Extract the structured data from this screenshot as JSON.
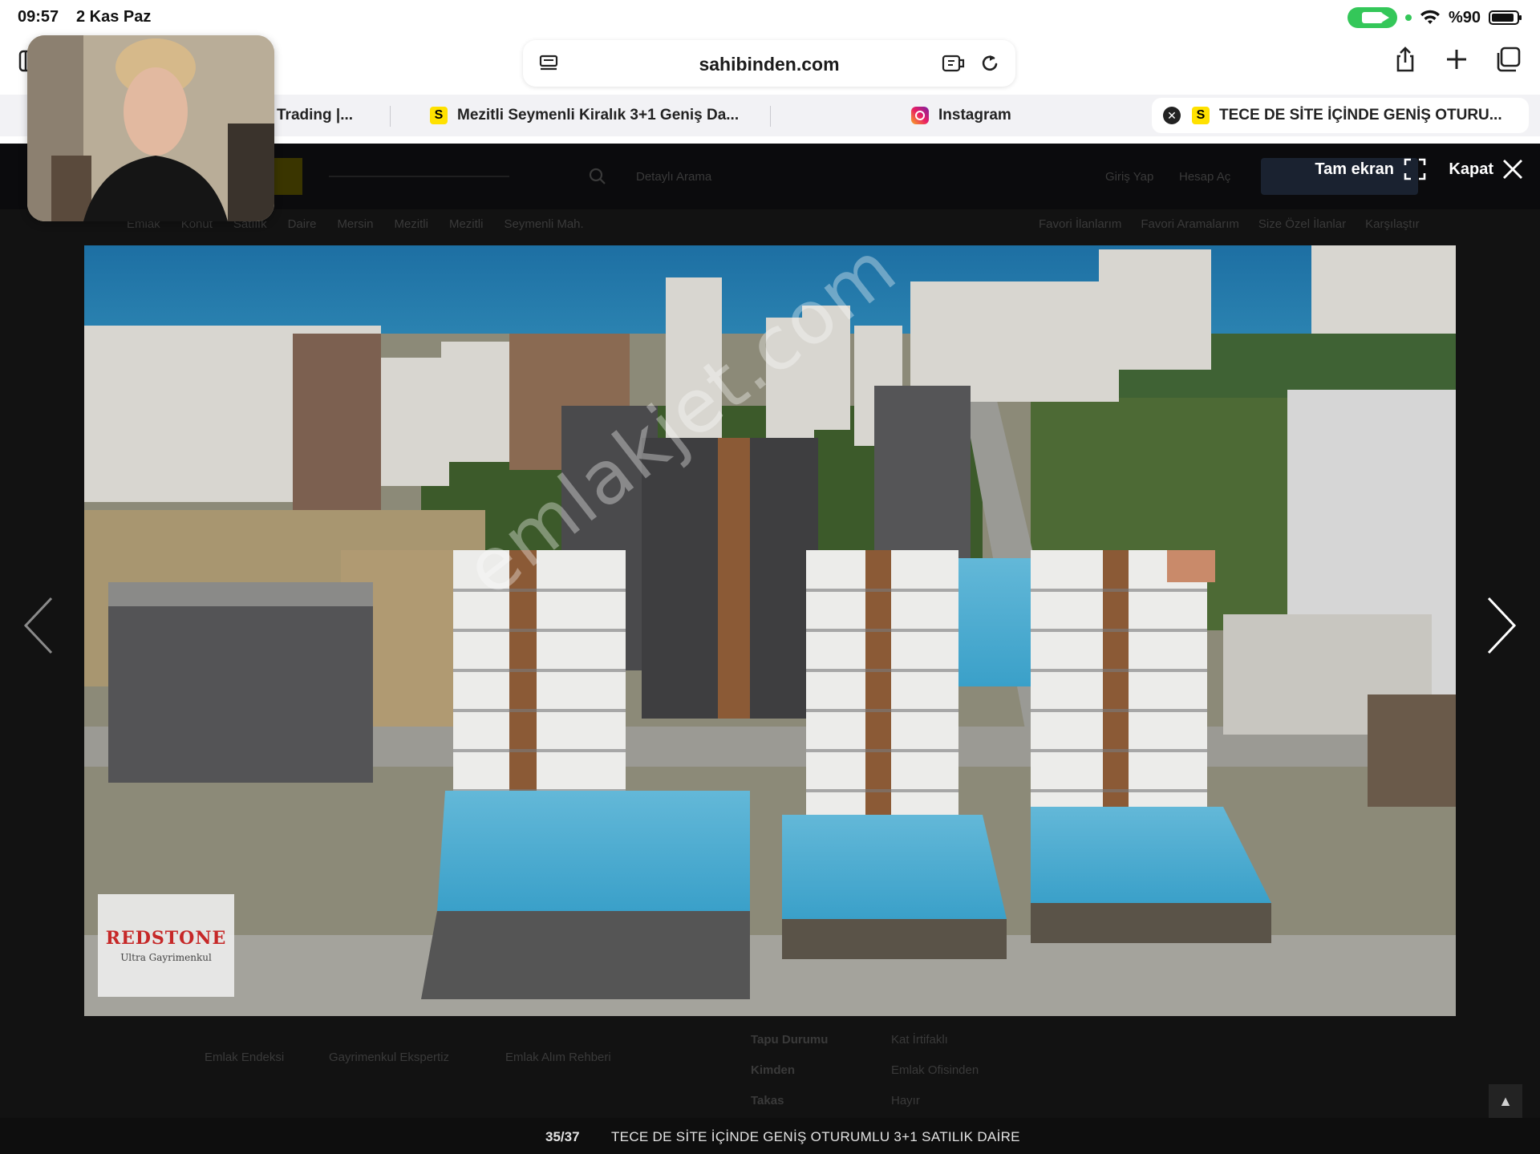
{
  "status": {
    "time": "09:57",
    "date": "2 Kas Paz",
    "battery": "%90",
    "battery_level": 0.9
  },
  "browser": {
    "url": "sahibinden.com",
    "tabs": [
      {
        "label": "Trading |...",
        "favicon": "none"
      },
      {
        "label": "Mezitli Seymenli Kiralık 3+1 Geniş Da...",
        "favicon": "sahibinden-icon"
      },
      {
        "label": "Instagram",
        "favicon": "instagram-icon"
      },
      {
        "label": "TECE DE SİTE İÇİNDE GENİŞ OTURU...",
        "favicon": "sahibinden-icon",
        "active": true
      }
    ]
  },
  "lightbox": {
    "fullscreen_label": "Tam ekran",
    "close_label": "Kapat",
    "counter": "35/37",
    "caption": "TECE DE SİTE İÇİNDE GENİŞ OTURUMLU 3+1 SATILIK DAİRE",
    "watermark": "emlakjet.com",
    "logo_brand": "REDSTONE",
    "logo_sub": "Ultra Gayrimenkul"
  },
  "background_page": {
    "nav_links": [
      "Detaylı Arama",
      "Giriş Yap",
      "Hesap Aç"
    ],
    "breadcrumb": [
      "Emlak",
      "Konut",
      "Satılık",
      "Daire",
      "Mersin",
      "Mezitli",
      "Mezitli",
      "Seymenli Mah."
    ],
    "tools": [
      "Favori İlanlarım",
      "Favori Aramalarım",
      "Size Özel İlanlar",
      "Karşılaştır"
    ],
    "footer_links": [
      "Emlak Endeksi",
      "Gayrimenkul Ekspertiz",
      "Emlak Alım Rehberi"
    ],
    "details": [
      {
        "label": "Tapu Durumu",
        "value": "Kat İrtifaklı"
      },
      {
        "label": "Kimden",
        "value": "Emlak Ofisinden"
      },
      {
        "label": "Takas",
        "value": "Hayır"
      }
    ]
  },
  "colors": {
    "accent_green": "#34c759",
    "sahibinden_yellow": "#ffe100",
    "logo_red": "#c62828"
  }
}
